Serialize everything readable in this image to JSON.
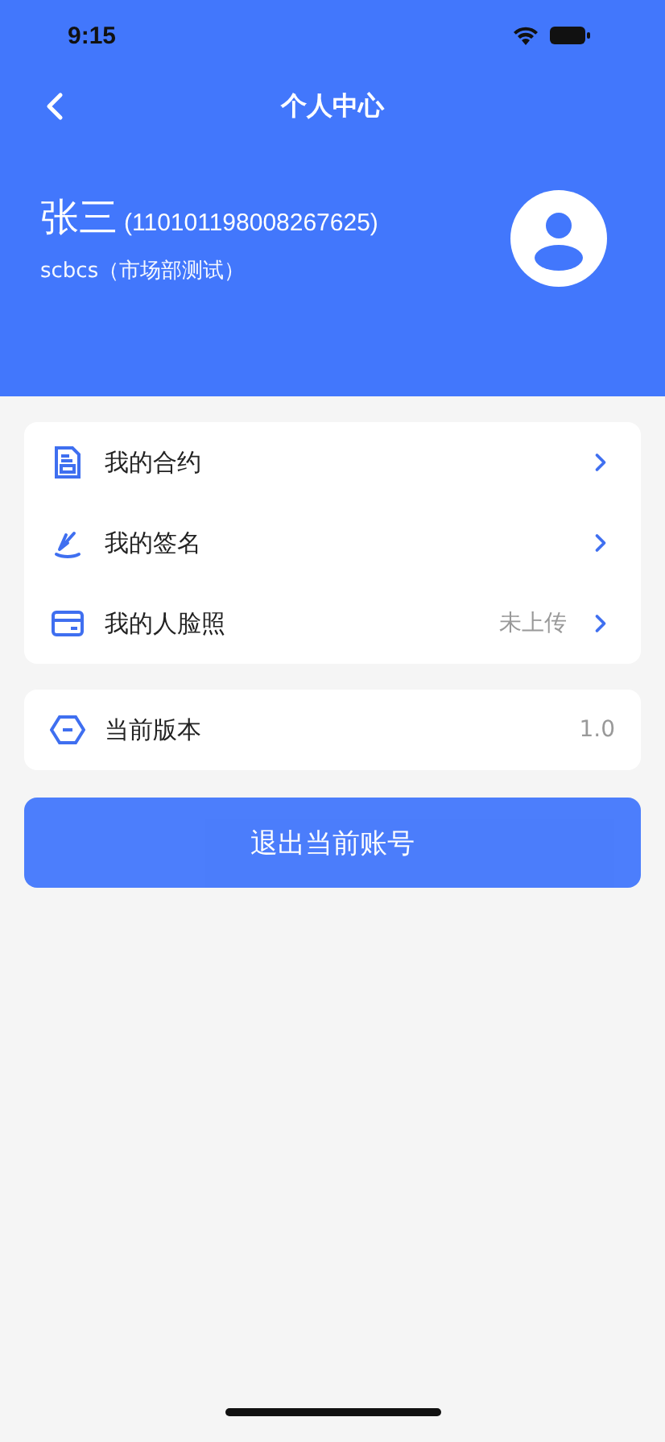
{
  "status_bar": {
    "time": "9:15"
  },
  "nav": {
    "title": "个人中心"
  },
  "profile": {
    "name": "张三",
    "id_number": "(110101198008267625)",
    "account": "scbcs（市场部测试）"
  },
  "menu_groups": [
    {
      "items": [
        {
          "kind": "contract",
          "label": "我的合约",
          "value": null,
          "arrow": true
        },
        {
          "kind": "signature",
          "label": "我的签名",
          "value": null,
          "arrow": true
        },
        {
          "kind": "face",
          "label": "我的人脸照",
          "value": "未上传",
          "arrow": true
        }
      ]
    },
    {
      "items": [
        {
          "kind": "version",
          "label": "当前版本",
          "value": "1.0",
          "arrow": false
        }
      ]
    }
  ],
  "logout_button": "退出当前账号"
}
